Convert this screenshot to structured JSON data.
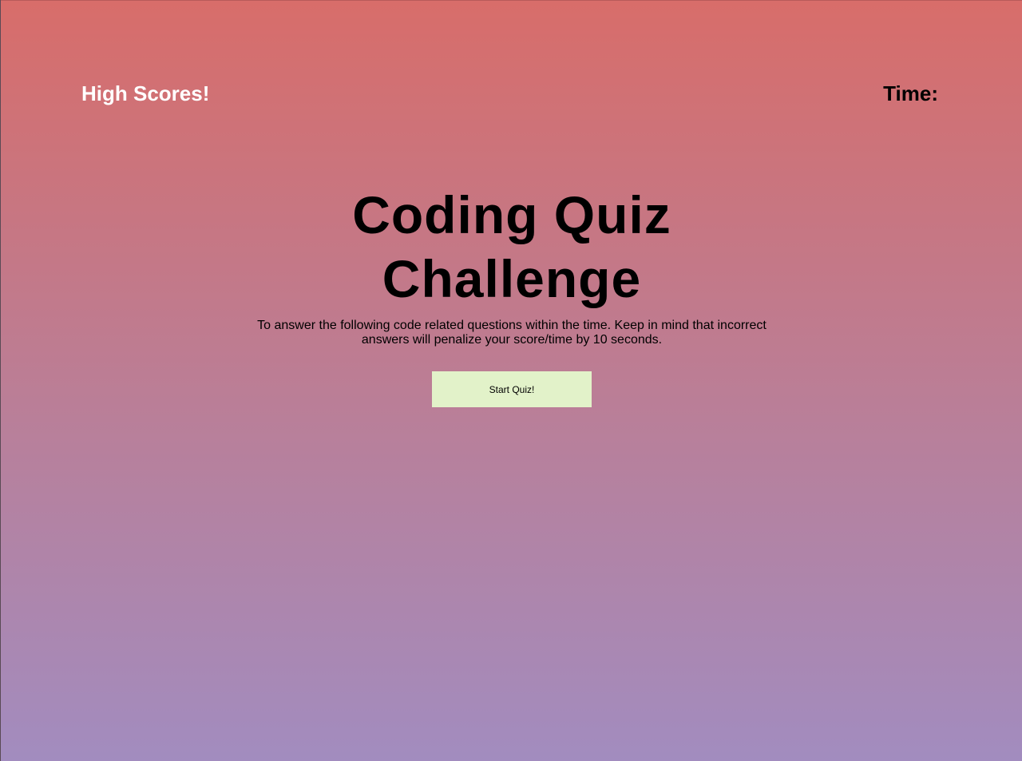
{
  "header": {
    "high_scores_label": "High Scores!",
    "time_label": "Time:",
    "time_value": ""
  },
  "main": {
    "title": "Coding Quiz Challenge",
    "intro": "To answer the following code related questions within the time. Keep in mind that incorrect answers will penalize your score/time by 10 seconds.",
    "start_button_label": "Start Quiz!"
  },
  "colors": {
    "gradient_top": "#d86d6a",
    "gradient_bottom": "#a28cbf",
    "button_bg": "#e2f2c9",
    "link_color": "#ffffff"
  }
}
